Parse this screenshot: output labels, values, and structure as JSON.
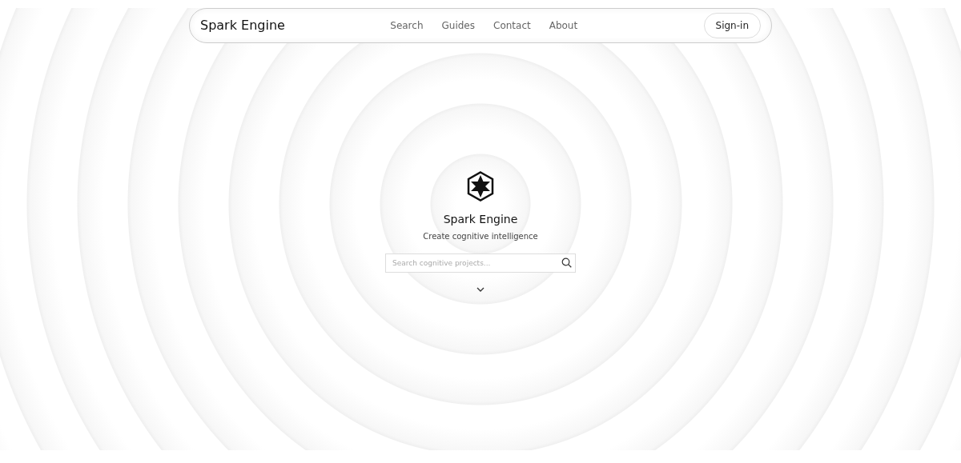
{
  "navbar": {
    "brand": "Spark Engine",
    "links": [
      {
        "label": "Search"
      },
      {
        "label": "Guides"
      },
      {
        "label": "Contact"
      },
      {
        "label": "About"
      }
    ],
    "sign_in": "Sign-in"
  },
  "hero": {
    "title": "Spark Engine",
    "subtitle": "Create cognitive intelligence",
    "search": {
      "placeholder": "Search cognitive projects..."
    }
  }
}
